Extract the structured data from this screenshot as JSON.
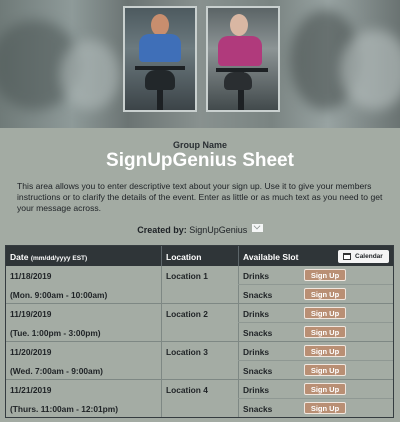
{
  "header": {
    "group_name": "Group Name",
    "title": "SignUpGenius Sheet",
    "description": "This area allows you to enter descriptive text about your sign up. Use it to give your members instructions or to clarify the details of the event. Enter as little or as much text as you need to get your message across.",
    "created_by_label": "Created by:",
    "created_by_name": "SignUpGenius"
  },
  "table": {
    "headers": {
      "date": "Date",
      "date_format": "(mm/dd/yyyy EST)",
      "location": "Location",
      "slot": "Available Slot",
      "calendar_button": "Calendar"
    },
    "signup_label": "Sign Up",
    "rows": [
      {
        "date": "11/18/2019",
        "time": "(Mon. 9:00am - 10:00am)",
        "location": "Location 1",
        "slots": [
          "Drinks",
          "Snacks"
        ]
      },
      {
        "date": "11/19/2019",
        "time": "(Tue. 1:00pm - 3:00pm)",
        "location": "Location 2",
        "slots": [
          "Drinks",
          "Snacks"
        ]
      },
      {
        "date": "11/20/2019",
        "time": "(Wed. 7:00am - 9:00am)",
        "location": "Location 3",
        "slots": [
          "Drinks",
          "Snacks"
        ]
      },
      {
        "date": "11/21/2019",
        "time": "(Thurs. 11:00am - 12:01pm)",
        "location": "Location 4",
        "slots": [
          "Drinks",
          "Snacks"
        ]
      }
    ]
  },
  "colors": {
    "background": "#a3aba3",
    "header_bar": "#2f3538",
    "signup_button": "#b98f74",
    "title": "#ffffff"
  }
}
